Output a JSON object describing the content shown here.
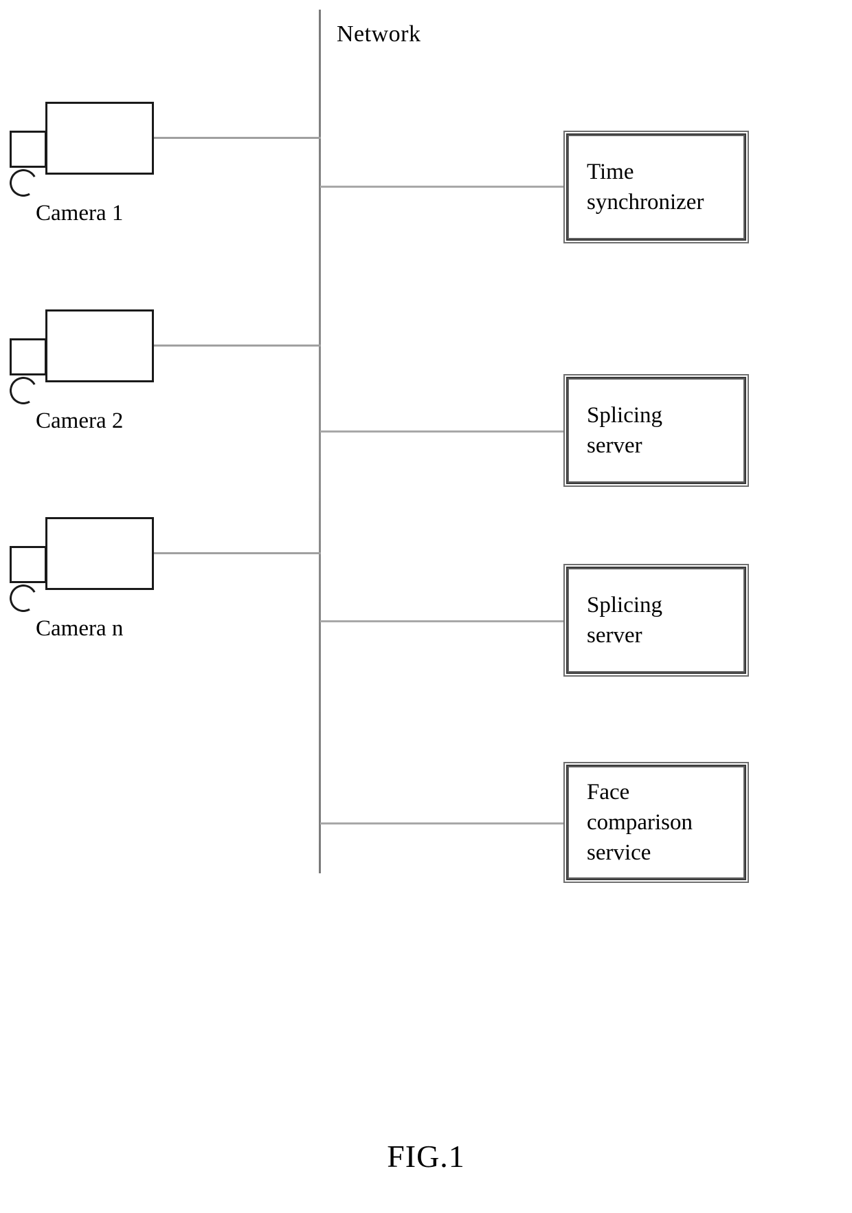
{
  "figure": {
    "caption": "FIG.1",
    "network_label": "Network"
  },
  "cameras": [
    {
      "id": "camera-1",
      "label": "Camera 1",
      "icon": "camera-icon"
    },
    {
      "id": "camera-2",
      "label": "Camera 2",
      "icon": "camera-icon"
    },
    {
      "id": "camera-n",
      "label": "Camera n",
      "icon": "camera-icon"
    }
  ],
  "nodes": [
    {
      "id": "time-synchronizer",
      "label": "Time\nsynchronizer"
    },
    {
      "id": "splicing-server-1",
      "label": "Splicing\nserver"
    },
    {
      "id": "splicing-server-2",
      "label": "Splicing\nserver"
    },
    {
      "id": "face-comparison-service",
      "label": "Face\ncomparison\nservice"
    }
  ],
  "colors": {
    "ink": "#000000",
    "line": "#8c8c8c",
    "box_border": "#3a3a3a",
    "background": "#ffffff"
  }
}
